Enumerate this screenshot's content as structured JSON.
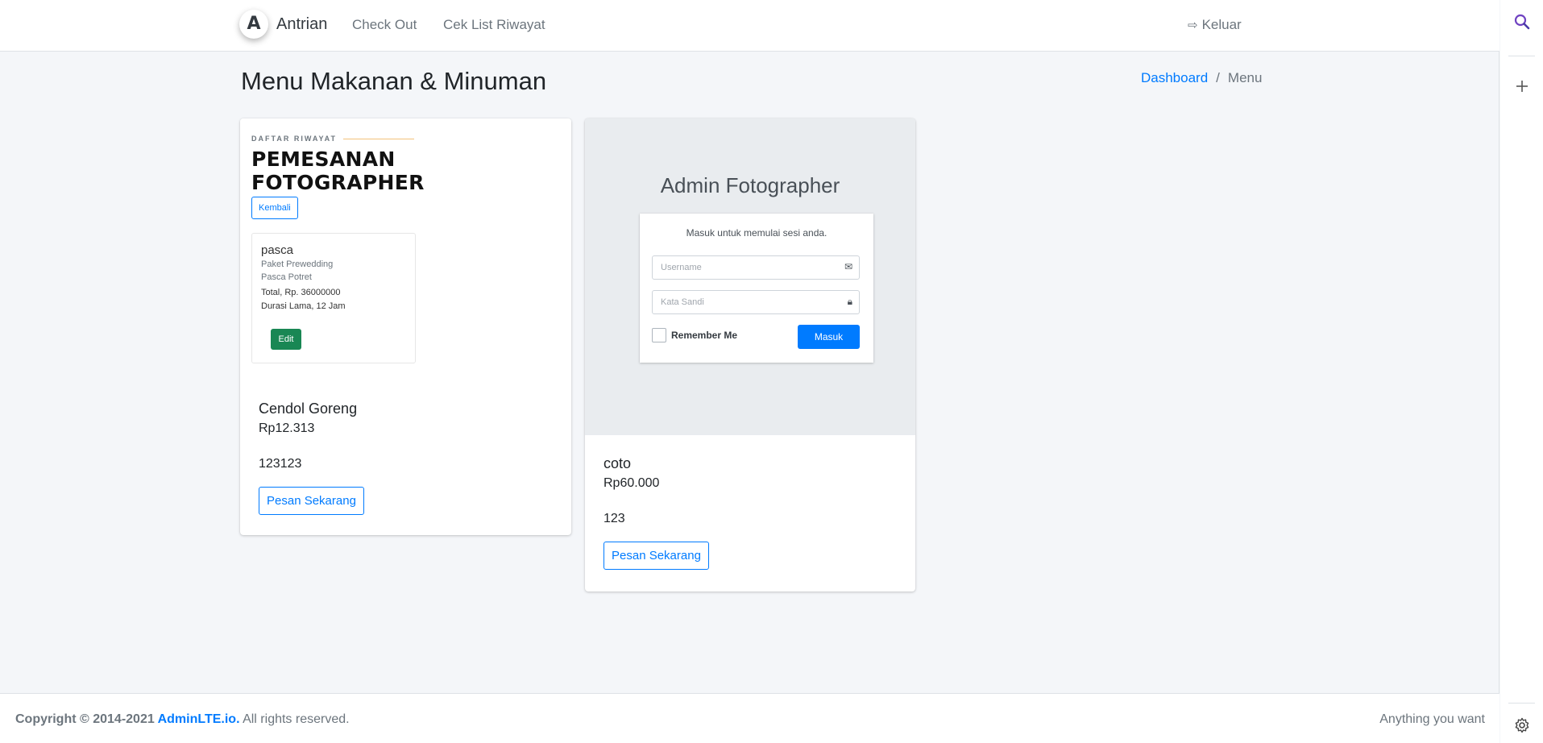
{
  "navbar": {
    "brand_logo": "A",
    "brand_name": "Antrian",
    "links": [
      "Check Out",
      "Cek List Riwayat"
    ],
    "logout_label": "Keluar"
  },
  "header": {
    "title": "Menu Makanan & Minuman",
    "breadcrumb": {
      "home": "Dashboard",
      "separator": "/",
      "current": "Menu"
    }
  },
  "items": [
    {
      "image": {
        "kind": "order-history-screenshot",
        "small_label": "DAFTAR RIWAYAT",
        "title": "PEMESANAN FOTOGRAPHER",
        "back_button": "Kembali",
        "order": {
          "name": "pasca",
          "package": "Paket Prewedding",
          "location": "Pasca Potret",
          "total": "Total, Rp. 36000000",
          "duration": "Durasi Lama, 12 Jam",
          "edit_button": "Edit"
        }
      },
      "name": "Cendol Goreng",
      "price": "Rp12.313",
      "description": "123123",
      "order_button": "Pesan Sekarang"
    },
    {
      "image": {
        "kind": "admin-login-screenshot",
        "title_bold": "Admin",
        "title_light": " Fotographer",
        "message": "Masuk untuk memulai sesi anda.",
        "username_placeholder": "Username",
        "password_placeholder": "Kata Sandi",
        "remember_label": "Remember Me",
        "login_button": "Masuk"
      },
      "name": "coto",
      "price": "Rp60.000",
      "description": "123",
      "order_button": "Pesan Sekarang"
    }
  ],
  "footer": {
    "copyright_prefix": "Copyright © 2014-2021 ",
    "brand_link": "AdminLTE.io.",
    "suffix": " All rights reserved.",
    "right_text": "Anything you want"
  },
  "sidebar_right": {
    "icons": [
      "search-icon",
      "plus-icon",
      "settings-icon"
    ]
  },
  "colors": {
    "primary": "#007bff",
    "success": "#198754",
    "background": "#f4f6f9"
  }
}
